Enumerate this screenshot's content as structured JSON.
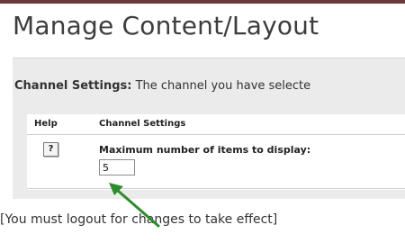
{
  "page": {
    "title": "Manage Content/Layout",
    "logout_note": "[You must logout for changes to take effect]"
  },
  "channel_settings": {
    "heading": "Channel Settings:",
    "description": "The channel you have selecte"
  },
  "settings_table": {
    "columns": [
      "Help",
      "Channel Settings"
    ],
    "help_button_label": "?",
    "field_label": "Maximum number of items to display:",
    "field_value": "5"
  },
  "colors": {
    "annotation_arrow": "#2e8b2e",
    "panel_background": "#ebebeb",
    "top_rule": "#6b3a3a"
  },
  "icons": {
    "help": "help-question-icon",
    "annotation": "arrow-pointer-icon"
  }
}
